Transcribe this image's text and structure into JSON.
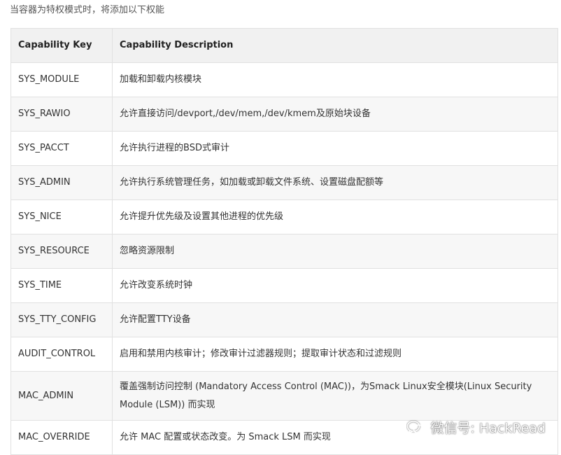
{
  "intro_text": "当容器为特权模式时，将添加以下权能",
  "table": {
    "headers": [
      "Capability Key",
      "Capability Description"
    ],
    "rows": [
      {
        "key": "SYS_MODULE",
        "desc": "加载和卸载内核模块"
      },
      {
        "key": "SYS_RAWIO",
        "desc": "允许直接访问/devport,/dev/mem,/dev/kmem及原始块设备"
      },
      {
        "key": "SYS_PACCT",
        "desc": "允许执行进程的BSD式审计"
      },
      {
        "key": "SYS_ADMIN",
        "desc": "允许执行系统管理任务，如加载或卸载文件系统、设置磁盘配额等"
      },
      {
        "key": "SYS_NICE",
        "desc": "允许提升优先级及设置其他进程的优先级"
      },
      {
        "key": "SYS_RESOURCE",
        "desc": "忽略资源限制"
      },
      {
        "key": "SYS_TIME",
        "desc": "允许改变系统时钟"
      },
      {
        "key": "SYS_TTY_CONFIG",
        "desc": "允许配置TTY设备"
      },
      {
        "key": "AUDIT_CONTROL",
        "desc": "启用和禁用内核审计；修改审计过滤器规则；提取审计状态和过滤规则"
      },
      {
        "key": "MAC_ADMIN",
        "desc": "覆盖强制访问控制 (Mandatory Access Control (MAC))，为Smack Linux安全模块(Linux Security Module (LSM)) 而实现"
      },
      {
        "key": "MAC_OVERRIDE",
        "desc": "允许 MAC 配置或状态改变。为 Smack LSM 而实现"
      }
    ]
  },
  "watermark": {
    "icon": "wechat-icon",
    "text": "微信号: HackRead"
  }
}
